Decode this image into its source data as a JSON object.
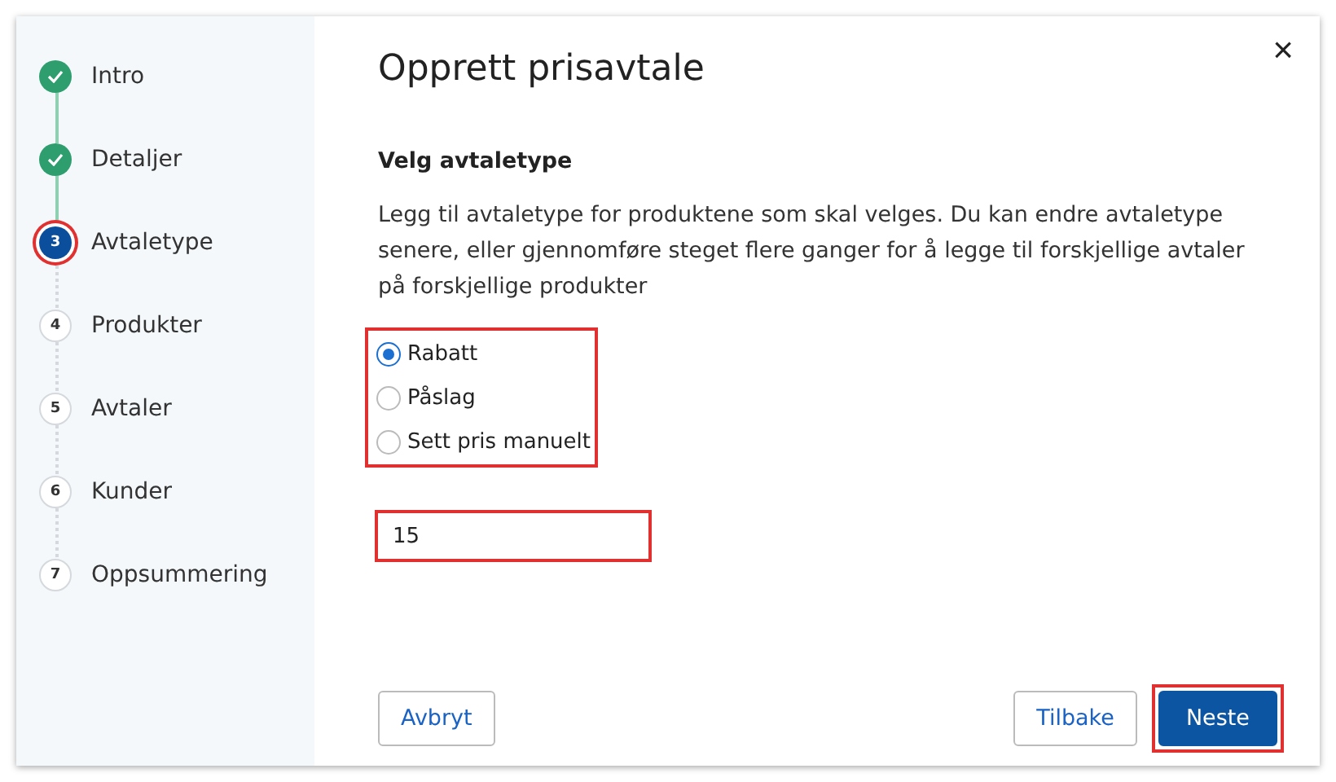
{
  "steps": [
    {
      "label": "Intro",
      "kind": "done"
    },
    {
      "label": "Detaljer",
      "kind": "done"
    },
    {
      "number": "3",
      "label": "Avtaletype",
      "kind": "current"
    },
    {
      "number": "4",
      "label": "Produkter",
      "kind": "upcoming"
    },
    {
      "number": "5",
      "label": "Avtaler",
      "kind": "upcoming"
    },
    {
      "number": "6",
      "label": "Kunder",
      "kind": "upcoming"
    },
    {
      "number": "7",
      "label": "Oppsummering",
      "kind": "upcoming"
    }
  ],
  "dialog": {
    "title": "Opprett prisavtale",
    "close": "×"
  },
  "section_title": "Velg avtaletype",
  "description": "Legg til avtaletype for produktene som skal velges. Du kan endre avtaletype senere, eller gjennomføre steget flere ganger for å legge til forskjellige avtaler på forskjellige produkter",
  "options": {
    "highlighted": true,
    "items": [
      {
        "label": "Rabatt",
        "selected": true
      },
      {
        "label": "Påslag",
        "selected": false
      },
      {
        "label": "Sett pris manuelt",
        "selected": false
      }
    ]
  },
  "amount_field": {
    "value": "15",
    "highlighted": true
  },
  "buttons": [
    {
      "label": "Avbryt",
      "kind": "secondary",
      "highlighted": false
    },
    {
      "label": "Tilbake",
      "kind": "secondary",
      "highlighted": false
    },
    {
      "label": "Neste",
      "kind": "primary",
      "highlighted": true
    }
  ]
}
